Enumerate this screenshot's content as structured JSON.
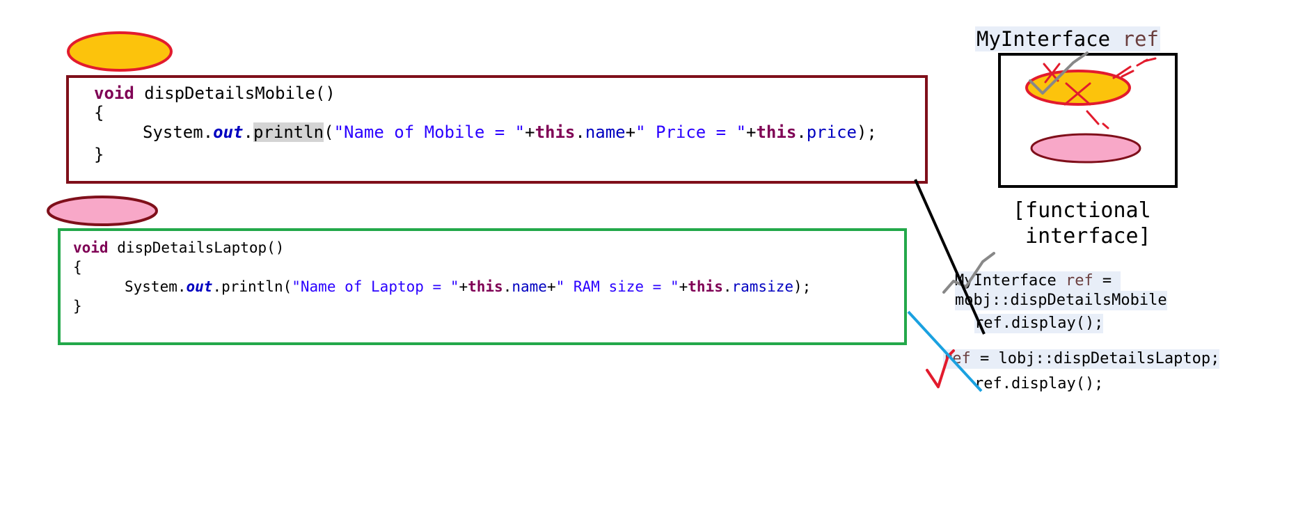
{
  "mobile_method": {
    "signature_kw": "void",
    "signature_name": " dispDetailsMobile()",
    "open_brace": "{",
    "stmt_prefix": "System.",
    "stmt_out": "out",
    "stmt_dot": ".",
    "stmt_println": "println",
    "stmt_paren": "(",
    "stmt_str1": "\"Name of Mobile = \"",
    "stmt_plus1": "+",
    "stmt_this1": "this",
    "stmt_dot1": ".",
    "stmt_field1": "name",
    "stmt_plus2": "+",
    "stmt_str2": "\" Price = \"",
    "stmt_plus3": "+",
    "stmt_this2": "this",
    "stmt_dot2": ".",
    "stmt_field2": "price",
    "stmt_end": ");",
    "close_brace": "}"
  },
  "laptop_method": {
    "signature_kw": "void",
    "signature_name": " dispDetailsLaptop()",
    "open_brace": "{",
    "stmt_prefix": "System.",
    "stmt_out": "out",
    "stmt_mid": ".println(",
    "stmt_str1": "\"Name of Laptop = \"",
    "stmt_plus1": "+",
    "stmt_this1": "this",
    "stmt_dot1": ".",
    "stmt_field1": "name",
    "stmt_plus2": "+",
    "stmt_str2": "\" RAM size = \"",
    "stmt_plus3": "+",
    "stmt_this2": "this",
    "stmt_dot2": ".",
    "stmt_field2": "ramsize",
    "stmt_end": ");",
    "close_brace": "}"
  },
  "interface_title": {
    "type": "MyInterface",
    "var": " ref"
  },
  "functional_label": {
    "line1": "[functional",
    "line2": " interface]"
  },
  "snippet_mobile": {
    "line1_type": "MyInterface",
    "line1_var": " ref",
    "line1_eq": " = ",
    "line2": "mobj::dispDetailsMobile",
    "line3": "ref.display();"
  },
  "snippet_laptop": {
    "line1_var": "ref",
    "line1_rest": " = lobj::dispDetailsLaptop;",
    "line2": "ref.display();"
  },
  "colors": {
    "mobile_box_border": "#7f0f1a",
    "laptop_box_border": "#23a84a",
    "yellow_ellipse": "#fcc30c",
    "pink_ellipse": "#f8a8c8",
    "ellipse_outline_red": "#e21b2d",
    "ellipse_outline_maroon": "#7f0f1a",
    "keyword": "#7f0055",
    "field": "#0000c0",
    "string": "#2a00ff",
    "connector_black": "#000000",
    "connector_blue": "#1aa1e0"
  }
}
